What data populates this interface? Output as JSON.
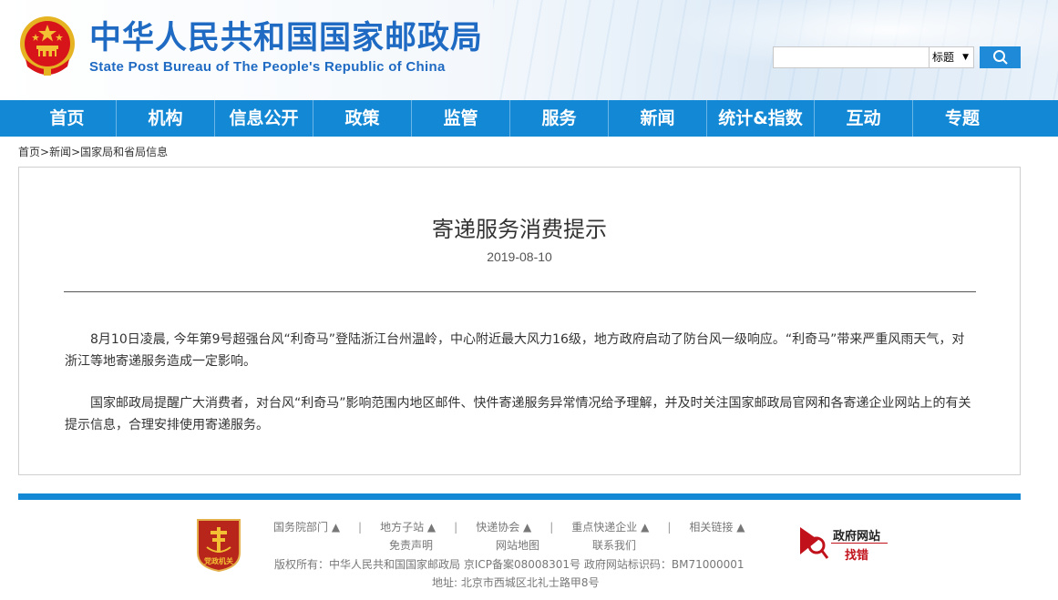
{
  "header": {
    "title": "中华人民共和国国家邮政局",
    "subtitle": "State Post Bureau of The People's Republic of China",
    "emblem_icon": "national-emblem-icon"
  },
  "search": {
    "placeholder": "",
    "scope_selected": "标题",
    "button_icon": "search-icon"
  },
  "nav": {
    "items": [
      "首页",
      "机构",
      "信息公开",
      "政策",
      "监管",
      "服务",
      "新闻",
      "统计&指数",
      "互动",
      "专题"
    ]
  },
  "breadcrumb": {
    "items": [
      "首页",
      "新闻",
      "国家局和省局信息"
    ],
    "separator": ">"
  },
  "article": {
    "title": "寄递服务消费提示",
    "date": "2019-08-10",
    "paragraphs": [
      "8月10日凌晨, 今年第9号超强台风“利奇马”登陆浙江台州温岭，中心附近最大风力16级，地方政府启动了防台风一级响应。“利奇马”带来严重风雨天气，对浙江等地寄递服务造成一定影响。",
      "国家邮政局提醒广大消费者，对台风“利奇马”影响范围内地区邮件、快件寄递服务异常情况给予理解，并及时关注国家邮政局官网和各寄递企业网站上的有关提示信息，合理安排使用寄递服务。"
    ]
  },
  "footer": {
    "badge_text": "党政机关",
    "links": [
      "国务院部门 ▲",
      "地方子站 ▲",
      "快递协会 ▲",
      "重点快递企业 ▲",
      "相关链接 ▲"
    ],
    "separator": "|",
    "row2": [
      "免责声明",
      "网站地图",
      "联系我们"
    ],
    "copyright": "版权所有：中华人民共和国国家邮政局  京ICP备案08008301号  政府网站标识码：BM71000001",
    "address": "地址: 北京市西城区北礼士路甲8号",
    "gov_site_label": "政府网站",
    "gov_site_action": "找错"
  },
  "colors": {
    "brand_blue": "#1f6ac2",
    "nav_blue": "#1388d5",
    "emblem_red": "#d7141a",
    "gold": "#f3c033"
  }
}
